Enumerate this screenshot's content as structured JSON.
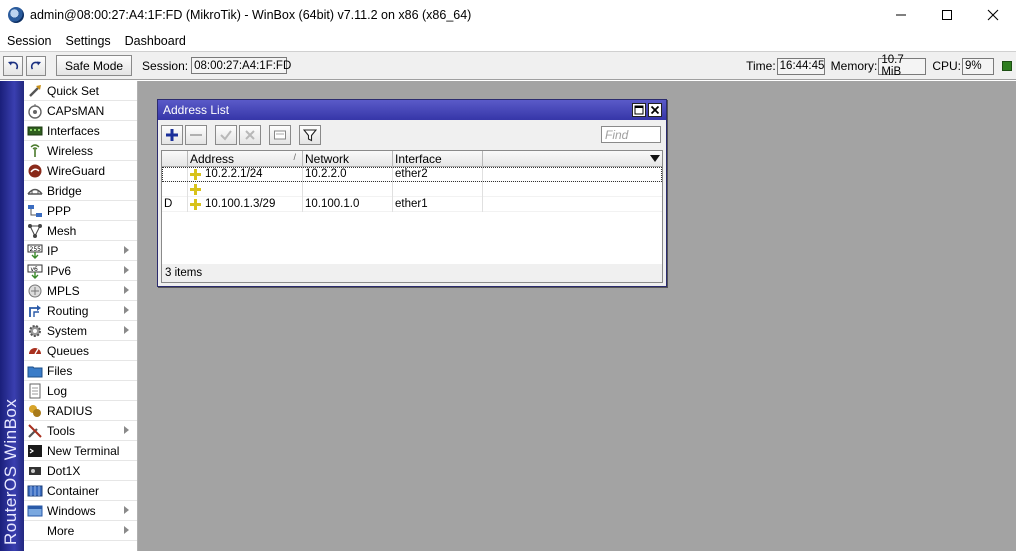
{
  "window": {
    "title": "admin@08:00:27:A4:1F:FD (MikroTik) - WinBox (64bit) v7.11.2 on x86 (x86_64)"
  },
  "menu": [
    "Session",
    "Settings",
    "Dashboard"
  ],
  "toolbar": {
    "safe_mode_label": "Safe Mode",
    "session_label": "Session:",
    "session_value": "08:00:27:A4:1F:FD",
    "time_label": "Time:",
    "time_value": "16:44:45",
    "memory_label": "Memory:",
    "memory_value": "10.7 MiB",
    "cpu_label": "CPU:",
    "cpu_value": "9%"
  },
  "brand": "RouterOS WinBox",
  "sidebar": {
    "items": [
      {
        "label": "Quick Set",
        "icon": "quick-set-icon",
        "submenu": false
      },
      {
        "label": "CAPsMAN",
        "icon": "capsman-icon",
        "submenu": false
      },
      {
        "label": "Interfaces",
        "icon": "interfaces-icon",
        "submenu": false
      },
      {
        "label": "Wireless",
        "icon": "wireless-icon",
        "submenu": false
      },
      {
        "label": "WireGuard",
        "icon": "wireguard-icon",
        "submenu": false
      },
      {
        "label": "Bridge",
        "icon": "bridge-icon",
        "submenu": false
      },
      {
        "label": "PPP",
        "icon": "ppp-icon",
        "submenu": false
      },
      {
        "label": "Mesh",
        "icon": "mesh-icon",
        "submenu": false
      },
      {
        "label": "IP",
        "icon": "ip-icon",
        "submenu": true
      },
      {
        "label": "IPv6",
        "icon": "ipv6-icon",
        "submenu": true
      },
      {
        "label": "MPLS",
        "icon": "mpls-icon",
        "submenu": true
      },
      {
        "label": "Routing",
        "icon": "routing-icon",
        "submenu": true
      },
      {
        "label": "System",
        "icon": "system-icon",
        "submenu": true
      },
      {
        "label": "Queues",
        "icon": "queues-icon",
        "submenu": false
      },
      {
        "label": "Files",
        "icon": "files-icon",
        "submenu": false
      },
      {
        "label": "Log",
        "icon": "log-icon",
        "submenu": false
      },
      {
        "label": "RADIUS",
        "icon": "radius-icon",
        "submenu": false
      },
      {
        "label": "Tools",
        "icon": "tools-icon",
        "submenu": true
      },
      {
        "label": "New Terminal",
        "icon": "terminal-icon",
        "submenu": false
      },
      {
        "label": "Dot1X",
        "icon": "dot1x-icon",
        "submenu": false
      },
      {
        "label": "Container",
        "icon": "container-icon",
        "submenu": false
      },
      {
        "label": "Windows",
        "icon": "windows-icon",
        "submenu": true
      },
      {
        "label": "More",
        "icon": "",
        "submenu": true
      }
    ]
  },
  "address_list": {
    "title": "Address List",
    "find_placeholder": "Find",
    "columns": [
      "",
      "Address",
      "Network",
      "Interface"
    ],
    "rows": [
      {
        "flag": "",
        "address": "10.2.2.1/24",
        "network": "10.2.2.0",
        "interface": "ether2"
      },
      {
        "flag": "",
        "address": "",
        "network": "",
        "interface": ""
      },
      {
        "flag": "D",
        "address": "10.100.1.3/29",
        "network": "10.100.1.0",
        "interface": "ether1"
      }
    ],
    "status": "3 items"
  },
  "colors": {
    "brand_bar": "#2a2f96",
    "workspace": "#a3a3a3",
    "window_title": "#4646b8",
    "cpu_led": "#2e7d1f",
    "plus_icon": "#d8c21a"
  }
}
